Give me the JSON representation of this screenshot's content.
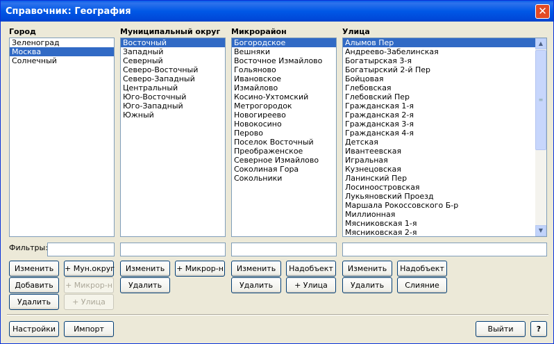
{
  "window": {
    "title": "Справочник: География",
    "close_glyph": "✕"
  },
  "columns": {
    "city": {
      "header": "Город",
      "items": [
        "Зеленоград",
        "Москва",
        "Солнечный"
      ],
      "selected": 1
    },
    "district": {
      "header": "Муниципальный округ",
      "items": [
        "Восточный",
        "Западный",
        "Северный",
        "Северо-Восточный",
        "Северо-Западный",
        "Центральный",
        "Юго-Восточный",
        "Юго-Западный",
        "Южный"
      ],
      "selected": 0
    },
    "microdistrict": {
      "header": "Микрорайон",
      "items": [
        "Богородское",
        "Вешняки",
        "Восточное Измайлово",
        "Гольяново",
        "Ивановское",
        "Измайлово",
        "Косино-Ухтомский",
        "Метрогородок",
        "Новогиреево",
        "Новокосино",
        "Перово",
        "Поселок Восточный",
        "Преображенское",
        "Северное Измайлово",
        "Соколиная Гора",
        "Сокольники"
      ],
      "selected": 0
    },
    "street": {
      "header": "Улица",
      "items": [
        "Алымов Пер",
        "Андреево-Забелинская",
        "Богатырская 3-я",
        "Богатырский 2-й Пер",
        "Бойцовая",
        "Глебовская",
        "Глебовский Пер",
        "Гражданская 1-я",
        "Гражданская 2-я",
        "Гражданская 3-я",
        "Гражданская 4-я",
        "Детская",
        "Ивантеевская",
        "Игральная",
        "Кузнецовская",
        "Ланинский Пер",
        "Лосиноостровская",
        "Лукьяновский Проезд",
        "Маршала Рокоссовского Б-р",
        "Миллионная",
        "Мясниковская 1-я",
        "Мясниковская 2-я"
      ],
      "selected": 0
    }
  },
  "filters": {
    "label": "Фильтры:",
    "city": "",
    "district": "",
    "microdistrict": "",
    "street": ""
  },
  "buttons": {
    "city_edit": "Изменить",
    "city_add": "Добавить",
    "city_delete": "Удалить",
    "add_district": "+ Мун.округ",
    "add_microdistrict_disabled": "+ Микрор-н",
    "add_street_disabled": "+ Улица",
    "district_edit": "Изменить",
    "district_delete": "Удалить",
    "district_add_microdistrict": "+ Микрор-н",
    "micro_edit": "Изменить",
    "micro_delete": "Удалить",
    "micro_parent": "Надобъект",
    "micro_add_street": "+ Улица",
    "street_edit": "Изменить",
    "street_delete": "Удалить",
    "street_parent": "Надобъект",
    "street_merge": "Слияние",
    "settings": "Настройки",
    "import": "Импорт",
    "exit": "Выйти",
    "help": "?"
  },
  "scrollbar": {
    "up_icon": "chevron-up-icon",
    "down_icon": "chevron-down-icon",
    "up_glyph": "▲",
    "down_glyph": "▼",
    "grip_glyph": "≡"
  }
}
